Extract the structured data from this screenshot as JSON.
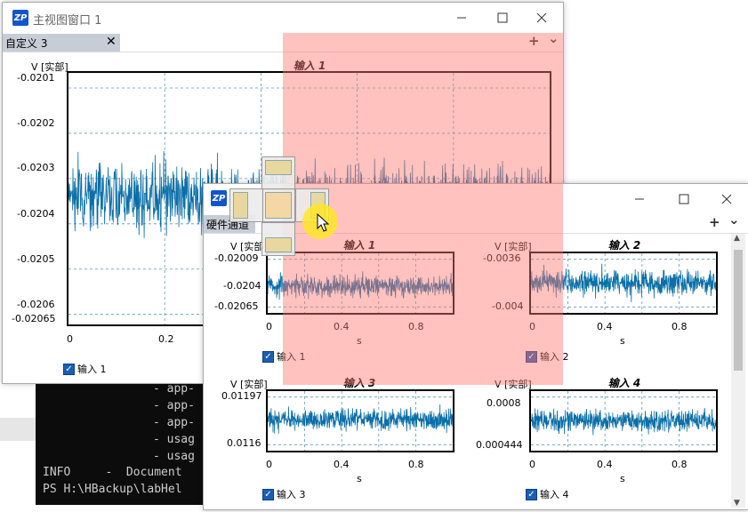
{
  "terminal": {
    "lines": [
      "- app-",
      "- app-",
      "- app-",
      "- usag",
      "- usag",
      "INFO     -  Document",
      "PS H:\\HBackup\\labHel"
    ]
  },
  "main_window": {
    "title": "主视图窗口 1",
    "logo": "ZP",
    "tab_label": "自定义 3",
    "close_glyph": "✕",
    "add_glyph": "+",
    "menu_glyph": "⌄",
    "chart_title": "输入 1",
    "ylabel": "V [实部]",
    "legend": "输入 1"
  },
  "second_window": {
    "logo": "ZP",
    "tab_label": "硬件通道",
    "add_glyph": "+",
    "menu_glyph": "⌄",
    "xlabel": "s"
  },
  "icons": {
    "minimize": "minimize-icon",
    "maximize": "maximize-icon",
    "close": "close-icon"
  },
  "colors": {
    "signal": "#0a6fa8",
    "overlay": "#ff786e",
    "tab_active": "#c7cdd6"
  },
  "chart_data": [
    {
      "type": "line",
      "title": "输入 1",
      "ylabel": "V [实部]",
      "xlabel": "",
      "x_ticks": [
        "0",
        "0.2"
      ],
      "y_ticks": [
        "-0.0201",
        "-0.0202",
        "-0.0203",
        "-0.0204",
        "-0.0205",
        "-0.0206",
        "-0.02065"
      ],
      "ylim": [
        -0.02065,
        -0.02008
      ],
      "xlim": [
        0,
        1
      ],
      "series": [
        {
          "name": "输入 1",
          "mean": -0.02035,
          "noise_amplitude": 5e-05
        }
      ],
      "grid": true
    },
    {
      "type": "line",
      "title": "输入 1",
      "ylabel": "V [实部]",
      "xlabel": "s",
      "x_ticks": [
        "0",
        "0.4",
        "0.8"
      ],
      "y_ticks": [
        "-0.02009",
        "-0.0204",
        "-0.02065"
      ],
      "ylim": [
        -0.02065,
        -0.02009
      ],
      "series": [
        {
          "name": "输入 1"
        }
      ],
      "grid": true
    },
    {
      "type": "line",
      "title": "输入 2",
      "ylabel": "V [实部]",
      "xlabel": "s",
      "x_ticks": [
        "0",
        "0.4",
        "0.8"
      ],
      "y_ticks": [
        "-0.0036",
        "-0.004"
      ],
      "ylim": [
        -0.0041,
        -0.0035
      ],
      "series": [
        {
          "name": "输入 2"
        }
      ],
      "grid": true
    },
    {
      "type": "line",
      "title": "输入 3",
      "ylabel": "V [实部]",
      "xlabel": "s",
      "x_ticks": [
        "0",
        "0.4",
        "0.8"
      ],
      "y_ticks": [
        "0.01197",
        "0.0116"
      ],
      "ylim": [
        0.01155,
        0.012
      ],
      "series": [
        {
          "name": "输入 3"
        }
      ],
      "grid": true
    },
    {
      "type": "line",
      "title": "输入 4",
      "ylabel": "V [实部]",
      "xlabel": "s",
      "x_ticks": [
        "0",
        "0.4",
        "0.8"
      ],
      "y_ticks": [
        "0.0008",
        "0.000444"
      ],
      "ylim": [
        0.00043,
        0.00083
      ],
      "series": [
        {
          "name": "输入 4"
        }
      ],
      "grid": true
    }
  ]
}
